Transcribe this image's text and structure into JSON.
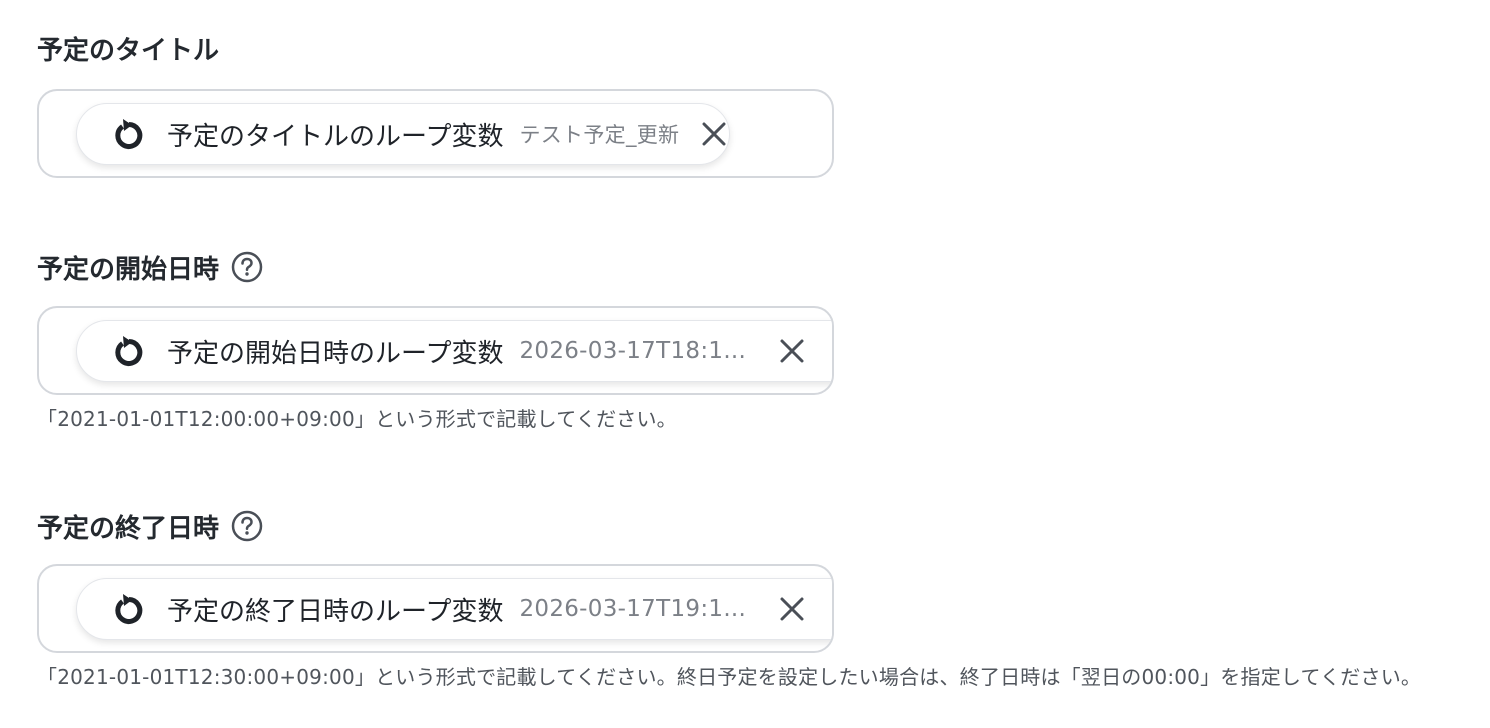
{
  "fields": [
    {
      "label": "予定のタイトル",
      "chip_name": "予定のタイトルのループ変数",
      "chip_value": "テスト予定_更新",
      "hint": ""
    },
    {
      "label": "予定の開始日時",
      "chip_name": "予定の開始日時のループ変数",
      "chip_value": "2026-03-17T18:1...",
      "hint": "「2021-01-01T12:00:00+09:00」という形式で記載してください。"
    },
    {
      "label": "予定の終了日時",
      "chip_name": "予定の終了日時のループ変数",
      "chip_value": "2026-03-17T19:1...",
      "hint": "「2021-01-01T12:30:00+09:00」という形式で記載してください。終日予定を設定したい場合は、終了日時は「翌日の00:00」を指定してください。"
    }
  ],
  "icons": {
    "loop": "loop-icon",
    "remove": "close-icon",
    "help": "help-icon"
  },
  "colors": {
    "border": "#d4d7dc",
    "label": "#24292f",
    "value": "#7c8087",
    "hint": "#50555c"
  }
}
